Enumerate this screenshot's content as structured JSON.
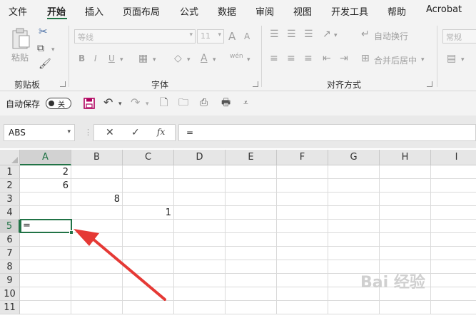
{
  "menu": [
    "文件",
    "开始",
    "插入",
    "页面布局",
    "公式",
    "数据",
    "审阅",
    "视图",
    "开发工具",
    "帮助",
    "Acrobat"
  ],
  "ribbon": {
    "clipboard": {
      "paste": "粘贴",
      "label": "剪贴板"
    },
    "font": {
      "name": "等线",
      "size": "11",
      "label": "字体",
      "grow": "A",
      "shrink": "A",
      "bold": "B",
      "italic": "I",
      "underline": "U",
      "wen": "wén"
    },
    "alignment": {
      "wrap": "自动换行",
      "merge": "合并后居中",
      "label": "对齐方式"
    },
    "number": {
      "format": "常规"
    }
  },
  "qat": {
    "autosave": "自动保存",
    "toggle": "关"
  },
  "namebox": "ABS",
  "formula": "=",
  "columns": [
    "A",
    "B",
    "C",
    "D",
    "E",
    "F",
    "G",
    "H",
    "I"
  ],
  "rows": [
    "1",
    "2",
    "3",
    "4",
    "5",
    "6",
    "7",
    "8",
    "9",
    "10",
    "11"
  ],
  "cells": {
    "A1": "2",
    "A2": "6",
    "B3": "8",
    "C4": "1",
    "A5": "="
  },
  "watermark": "Bai 经验",
  "colors": {
    "accent": "#217346",
    "arrow": "#e53935",
    "save": "#b0005e"
  }
}
